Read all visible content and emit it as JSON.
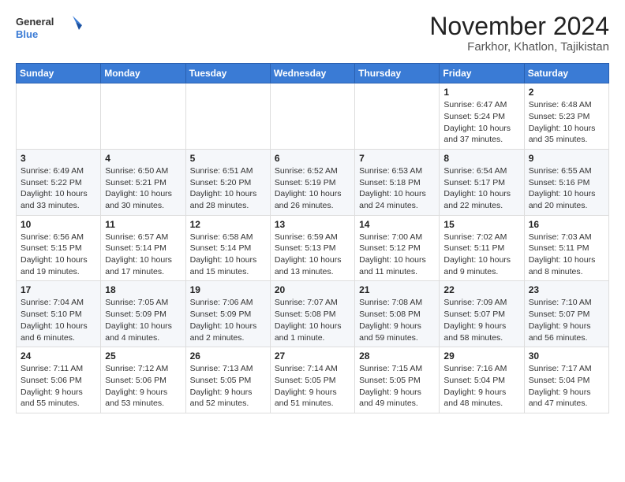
{
  "header": {
    "logo_general": "General",
    "logo_blue": "Blue",
    "month_title": "November 2024",
    "location": "Farkhor, Khatlon, Tajikistan"
  },
  "weekdays": [
    "Sunday",
    "Monday",
    "Tuesday",
    "Wednesday",
    "Thursday",
    "Friday",
    "Saturday"
  ],
  "weeks": [
    [
      {
        "day": "",
        "info": ""
      },
      {
        "day": "",
        "info": ""
      },
      {
        "day": "",
        "info": ""
      },
      {
        "day": "",
        "info": ""
      },
      {
        "day": "",
        "info": ""
      },
      {
        "day": "1",
        "info": "Sunrise: 6:47 AM\nSunset: 5:24 PM\nDaylight: 10 hours and 37 minutes."
      },
      {
        "day": "2",
        "info": "Sunrise: 6:48 AM\nSunset: 5:23 PM\nDaylight: 10 hours and 35 minutes."
      }
    ],
    [
      {
        "day": "3",
        "info": "Sunrise: 6:49 AM\nSunset: 5:22 PM\nDaylight: 10 hours and 33 minutes."
      },
      {
        "day": "4",
        "info": "Sunrise: 6:50 AM\nSunset: 5:21 PM\nDaylight: 10 hours and 30 minutes."
      },
      {
        "day": "5",
        "info": "Sunrise: 6:51 AM\nSunset: 5:20 PM\nDaylight: 10 hours and 28 minutes."
      },
      {
        "day": "6",
        "info": "Sunrise: 6:52 AM\nSunset: 5:19 PM\nDaylight: 10 hours and 26 minutes."
      },
      {
        "day": "7",
        "info": "Sunrise: 6:53 AM\nSunset: 5:18 PM\nDaylight: 10 hours and 24 minutes."
      },
      {
        "day": "8",
        "info": "Sunrise: 6:54 AM\nSunset: 5:17 PM\nDaylight: 10 hours and 22 minutes."
      },
      {
        "day": "9",
        "info": "Sunrise: 6:55 AM\nSunset: 5:16 PM\nDaylight: 10 hours and 20 minutes."
      }
    ],
    [
      {
        "day": "10",
        "info": "Sunrise: 6:56 AM\nSunset: 5:15 PM\nDaylight: 10 hours and 19 minutes."
      },
      {
        "day": "11",
        "info": "Sunrise: 6:57 AM\nSunset: 5:14 PM\nDaylight: 10 hours and 17 minutes."
      },
      {
        "day": "12",
        "info": "Sunrise: 6:58 AM\nSunset: 5:14 PM\nDaylight: 10 hours and 15 minutes."
      },
      {
        "day": "13",
        "info": "Sunrise: 6:59 AM\nSunset: 5:13 PM\nDaylight: 10 hours and 13 minutes."
      },
      {
        "day": "14",
        "info": "Sunrise: 7:00 AM\nSunset: 5:12 PM\nDaylight: 10 hours and 11 minutes."
      },
      {
        "day": "15",
        "info": "Sunrise: 7:02 AM\nSunset: 5:11 PM\nDaylight: 10 hours and 9 minutes."
      },
      {
        "day": "16",
        "info": "Sunrise: 7:03 AM\nSunset: 5:11 PM\nDaylight: 10 hours and 8 minutes."
      }
    ],
    [
      {
        "day": "17",
        "info": "Sunrise: 7:04 AM\nSunset: 5:10 PM\nDaylight: 10 hours and 6 minutes."
      },
      {
        "day": "18",
        "info": "Sunrise: 7:05 AM\nSunset: 5:09 PM\nDaylight: 10 hours and 4 minutes."
      },
      {
        "day": "19",
        "info": "Sunrise: 7:06 AM\nSunset: 5:09 PM\nDaylight: 10 hours and 2 minutes."
      },
      {
        "day": "20",
        "info": "Sunrise: 7:07 AM\nSunset: 5:08 PM\nDaylight: 10 hours and 1 minute."
      },
      {
        "day": "21",
        "info": "Sunrise: 7:08 AM\nSunset: 5:08 PM\nDaylight: 9 hours and 59 minutes."
      },
      {
        "day": "22",
        "info": "Sunrise: 7:09 AM\nSunset: 5:07 PM\nDaylight: 9 hours and 58 minutes."
      },
      {
        "day": "23",
        "info": "Sunrise: 7:10 AM\nSunset: 5:07 PM\nDaylight: 9 hours and 56 minutes."
      }
    ],
    [
      {
        "day": "24",
        "info": "Sunrise: 7:11 AM\nSunset: 5:06 PM\nDaylight: 9 hours and 55 minutes."
      },
      {
        "day": "25",
        "info": "Sunrise: 7:12 AM\nSunset: 5:06 PM\nDaylight: 9 hours and 53 minutes."
      },
      {
        "day": "26",
        "info": "Sunrise: 7:13 AM\nSunset: 5:05 PM\nDaylight: 9 hours and 52 minutes."
      },
      {
        "day": "27",
        "info": "Sunrise: 7:14 AM\nSunset: 5:05 PM\nDaylight: 9 hours and 51 minutes."
      },
      {
        "day": "28",
        "info": "Sunrise: 7:15 AM\nSunset: 5:05 PM\nDaylight: 9 hours and 49 minutes."
      },
      {
        "day": "29",
        "info": "Sunrise: 7:16 AM\nSunset: 5:04 PM\nDaylight: 9 hours and 48 minutes."
      },
      {
        "day": "30",
        "info": "Sunrise: 7:17 AM\nSunset: 5:04 PM\nDaylight: 9 hours and 47 minutes."
      }
    ]
  ]
}
